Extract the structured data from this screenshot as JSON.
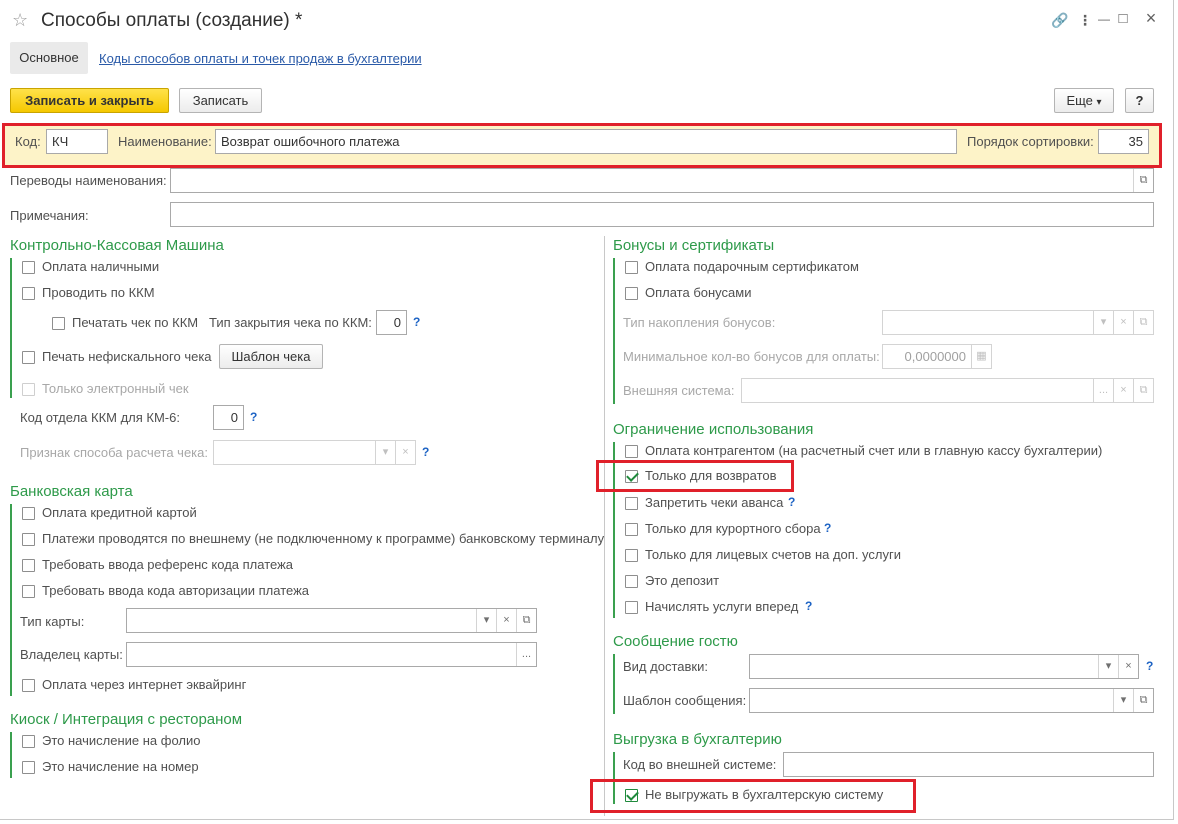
{
  "window": {
    "title": "Способы оплаты (создание) *",
    "controls": {
      "link": "🔗",
      "menu": "⋮",
      "minimize": "—",
      "maximize": "□",
      "close": "×"
    }
  },
  "tabs": {
    "main": "Основное",
    "codes_link": "Коды способов оплаты и точек продаж в бухгалтерии"
  },
  "toolbar": {
    "save_close": "Записать и закрыть",
    "save": "Записать",
    "more": "Еще",
    "help": "?"
  },
  "header_fields": {
    "code_label": "Код:",
    "code_value": "КЧ",
    "name_label": "Наименование:",
    "name_value": "Возврат ошибочного платежа",
    "sort_label": "Порядок сортировки:",
    "sort_value": "35"
  },
  "translations_label": "Переводы наименования:",
  "notes_label": "Примечания:",
  "kkm": {
    "title": "Контрольно-Кассовая Машина",
    "cash": "Оплата наличными",
    "post_kkm": "Проводить по ККМ",
    "print_receipt": "Печатать чек по ККМ",
    "close_type_label": "Тип закрытия чека по ККМ:",
    "close_type_value": "0",
    "nonfiscal": "Печать нефискального чека",
    "template_button": "Шаблон чека",
    "electronic_only": "Только электронный чек",
    "dept_label": "Код отдела ККМ для КМ-6:",
    "dept_value": "0",
    "calc_sign_label": "Признак способа расчета чека:"
  },
  "bank_card": {
    "title": "Банковская карта",
    "credit_card": "Оплата кредитной картой",
    "external_terminal": "Платежи проводятся по внешнему (не подключенному к программе) банковскому терминалу",
    "require_ref": "Требовать ввода референс кода платежа",
    "require_auth": "Требовать ввода кода авторизации платежа",
    "card_type_label": "Тип карты:",
    "card_owner_label": "Владелец карты:",
    "internet_acquiring": "Оплата через интернет эквайринг"
  },
  "kiosk": {
    "title": "Киоск / Интеграция с рестораном",
    "folio": "Это начисление на фолио",
    "room": "Это начисление на номер"
  },
  "bonuses": {
    "title": "Бонусы и сертификаты",
    "gift_cert": "Оплата подарочным сертификатом",
    "bonus_pay": "Оплата бонусами",
    "accum_type_label": "Тип накопления бонусов:",
    "min_bonus_label": "Минимальное кол-во бонусов для оплаты:",
    "min_bonus_value": "0,0000000",
    "ext_system_label": "Внешняя система:"
  },
  "restrictions": {
    "title": "Ограничение использования",
    "counterparty": "Оплата контрагентом (на расчетный счет или в главную кассу бухгалтерии)",
    "returns_only": "Только для возвратов",
    "no_advance": "Запретить чеки аванса",
    "resort_fee": "Только для курортного сбора",
    "personal_accounts": "Только для лицевых счетов на доп. услуги",
    "deposit": "Это депозит",
    "charge_ahead": "Начислять услуги вперед"
  },
  "guest_message": {
    "title": "Сообщение гостю",
    "delivery_label": "Вид доставки:",
    "template_label": "Шаблон сообщения:"
  },
  "accounting": {
    "title": "Выгрузка в бухгалтерию",
    "ext_code_label": "Код во внешней системе:",
    "no_export": "Не выгружать в бухгалтерскую систему"
  },
  "icons": {
    "star": "☆",
    "dropdown": "▾",
    "clear": "×",
    "open": "⧉",
    "ellipsis": "...",
    "calculator": "▦",
    "help": "?"
  },
  "colors": {
    "accent_green": "#2e9a4a",
    "highlight_red": "#e0202a",
    "primary_yellow": "#f5c800",
    "link_blue": "#2a5aa8"
  }
}
